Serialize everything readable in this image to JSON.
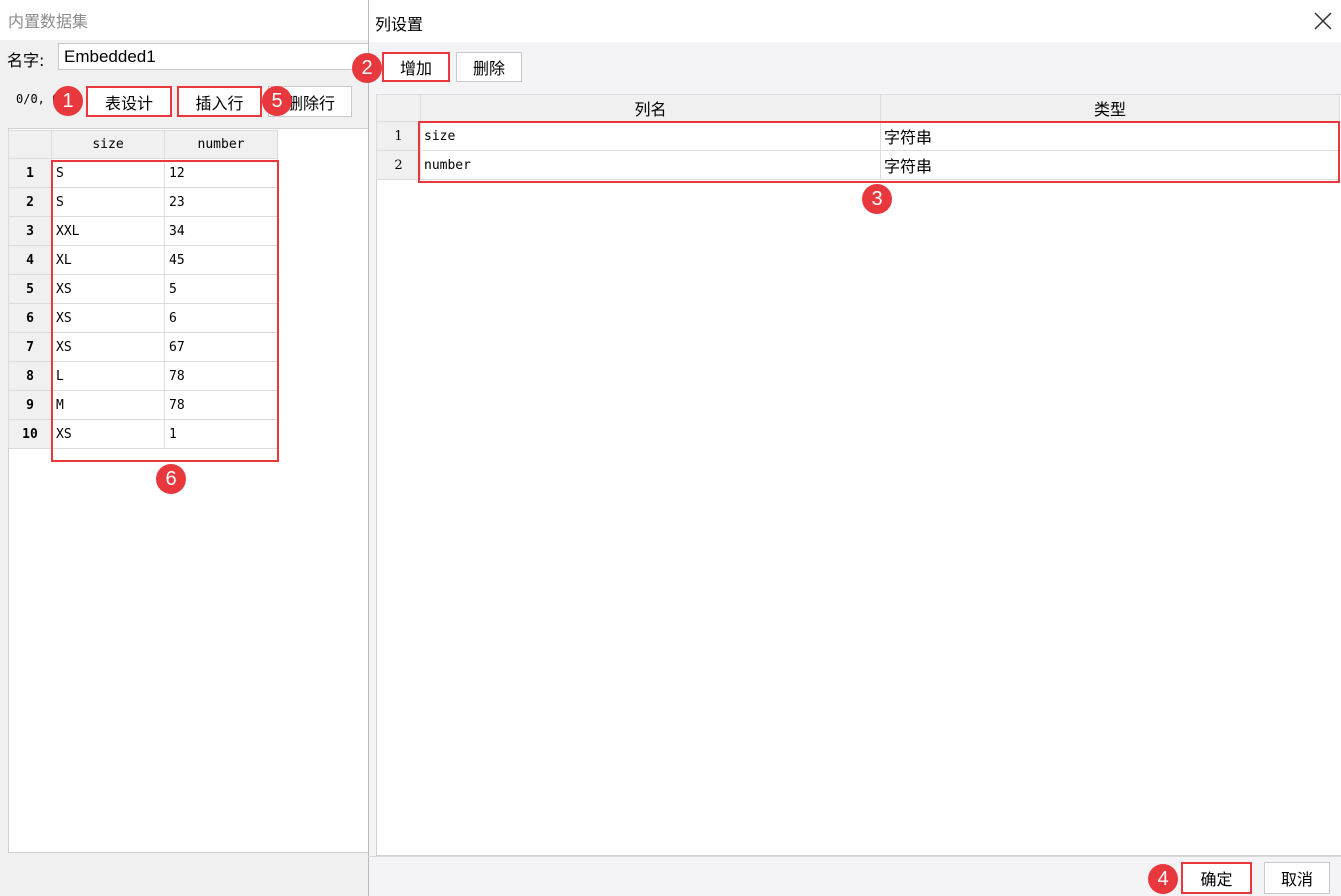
{
  "background_dialog": {
    "title": "内置数据集",
    "name_label": "名字:",
    "name_value": "Embedded1",
    "counter": "0/0, 0",
    "buttons": {
      "table_design": "表设计",
      "insert_row": "插入行",
      "delete_row": "删除行"
    },
    "columns": [
      "size",
      "number"
    ],
    "rows": [
      {
        "n": "1",
        "size": "S",
        "number": "12"
      },
      {
        "n": "2",
        "size": "S",
        "number": "23"
      },
      {
        "n": "3",
        "size": "XXL",
        "number": "34"
      },
      {
        "n": "4",
        "size": "XL",
        "number": "45"
      },
      {
        "n": "5",
        "size": "XS",
        "number": "5"
      },
      {
        "n": "6",
        "size": "XS",
        "number": "6"
      },
      {
        "n": "7",
        "size": "XS",
        "number": "67"
      },
      {
        "n": "8",
        "size": "L",
        "number": "78"
      },
      {
        "n": "9",
        "size": "M",
        "number": "78"
      },
      {
        "n": "10",
        "size": "XS",
        "number": "1"
      }
    ]
  },
  "column_dialog": {
    "title": "列设置",
    "close_icon": "close-icon",
    "buttons": {
      "add": "增加",
      "delete": "删除",
      "ok": "确定",
      "cancel": "取消"
    },
    "headers": {
      "name": "列名",
      "type": "类型"
    },
    "rows": [
      {
        "n": "1",
        "name": "size",
        "type": "字符串"
      },
      {
        "n": "2",
        "name": "number",
        "type": "字符串"
      }
    ]
  },
  "badges": [
    "1",
    "2",
    "3",
    "4",
    "5",
    "6"
  ],
  "colors": {
    "highlight": "#e8383d",
    "header_bg": "#f0f0f0"
  }
}
